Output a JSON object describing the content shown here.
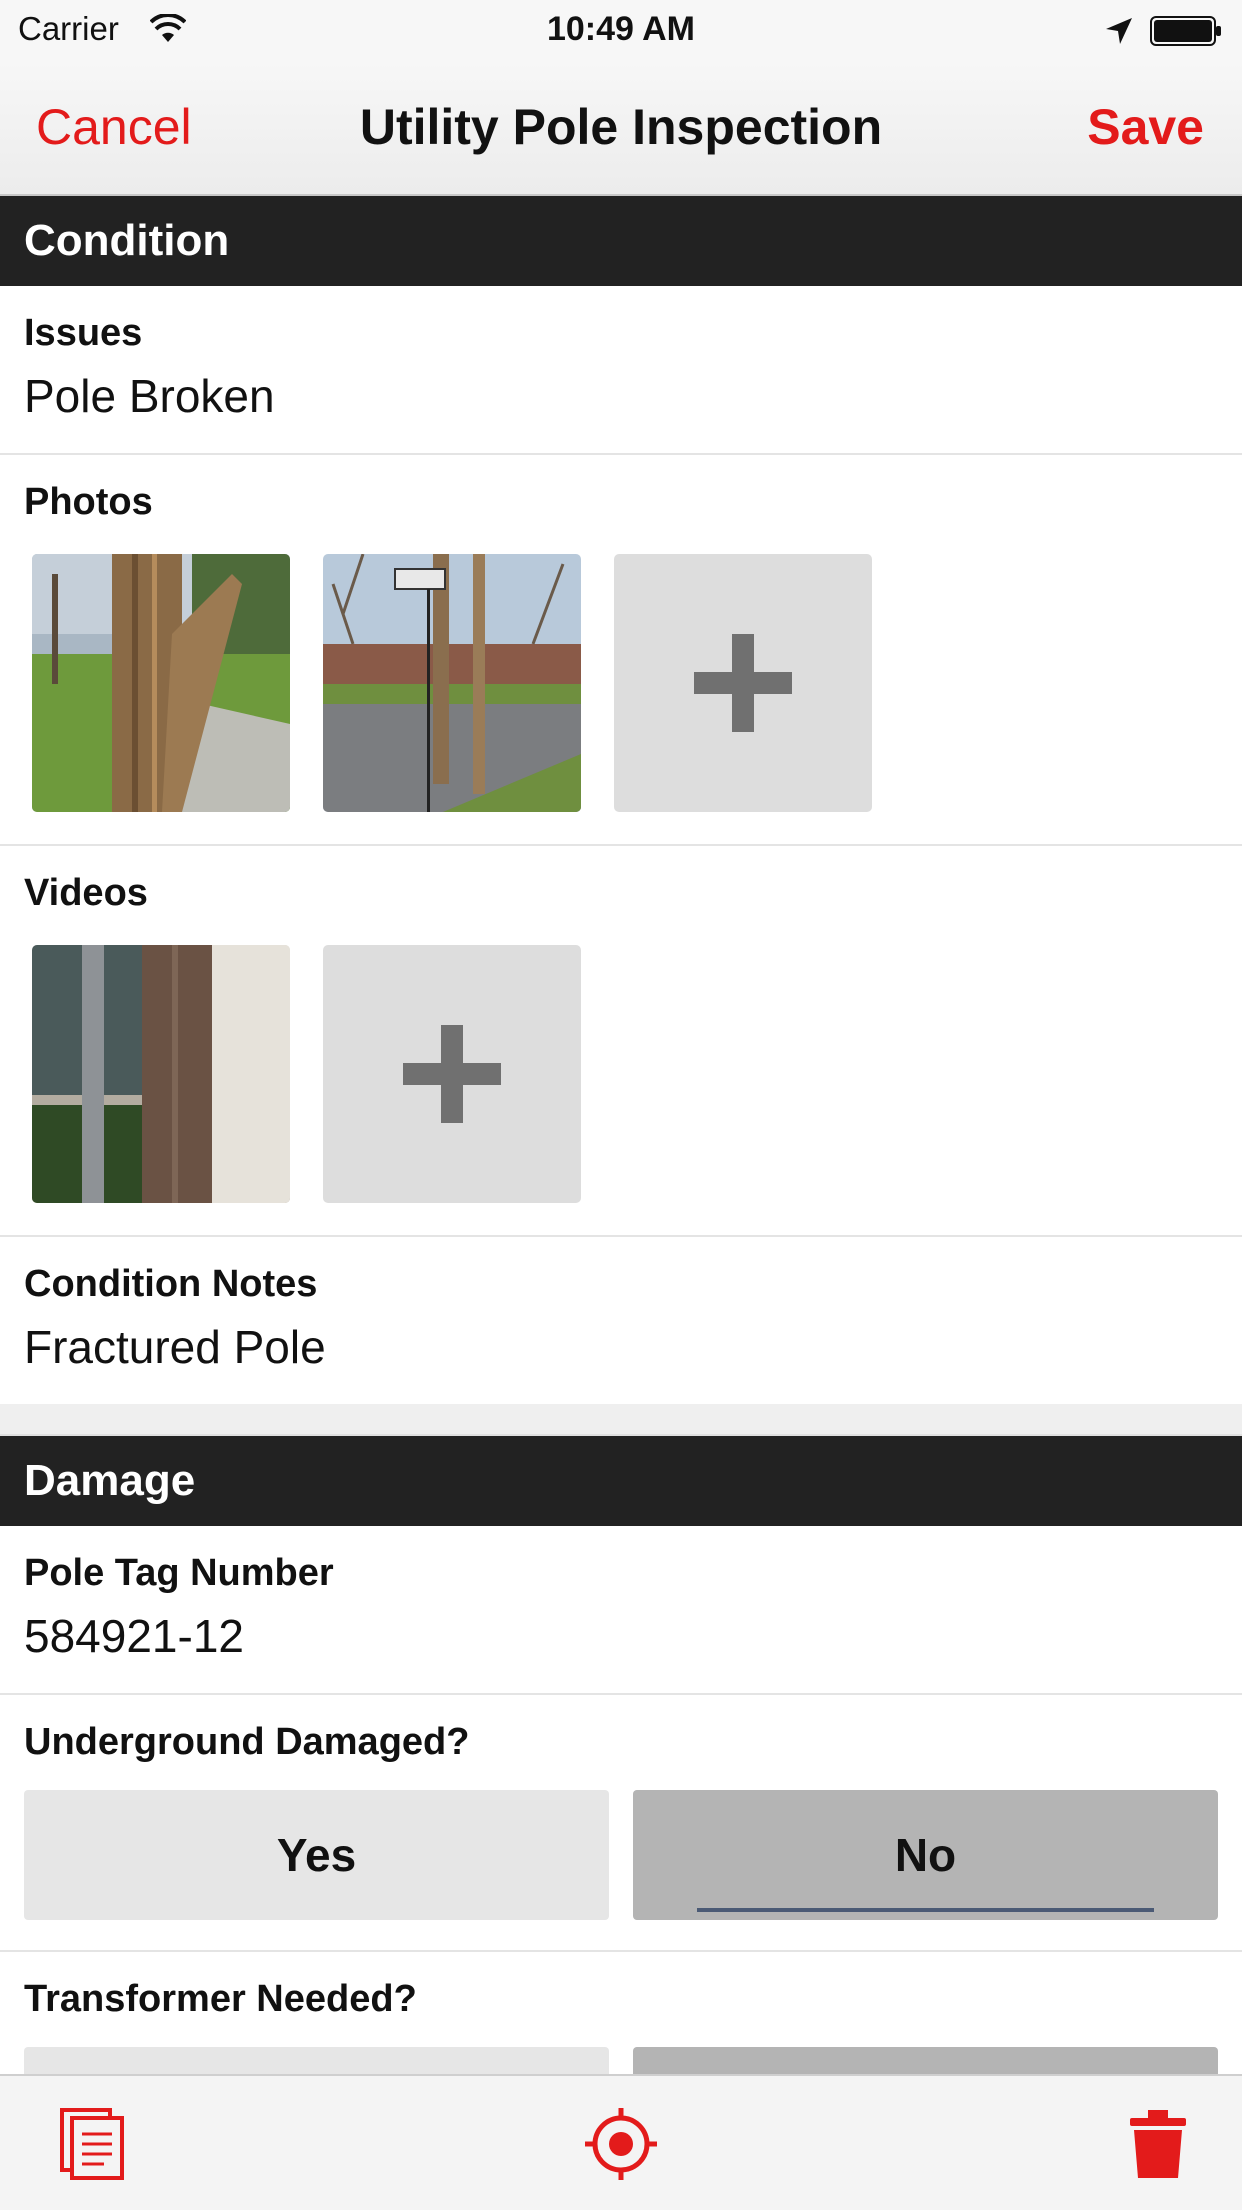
{
  "status_bar": {
    "carrier": "Carrier",
    "time": "10:49 AM",
    "icons": [
      "wifi-icon",
      "location-arrow-icon",
      "battery-icon"
    ]
  },
  "nav": {
    "cancel_label": "Cancel",
    "title": "Utility Pole Inspection",
    "save_label": "Save"
  },
  "condition": {
    "header": "Condition",
    "issues": {
      "label": "Issues",
      "value": "Pole Broken"
    },
    "photos": {
      "label": "Photos"
    },
    "videos": {
      "label": "Videos"
    },
    "notes": {
      "label": "Condition Notes",
      "value": "Fractured Pole"
    }
  },
  "damage": {
    "header": "Damage",
    "pole_tag": {
      "label": "Pole Tag Number",
      "value": "584921-12"
    },
    "underground": {
      "label": "Underground Damaged?",
      "options": [
        "Yes",
        "No"
      ],
      "selected": "No"
    },
    "transformer": {
      "label": "Transformer Needed?"
    }
  },
  "toolbar": {
    "icons": [
      "copy-document-icon",
      "locate-target-icon",
      "trash-icon"
    ]
  },
  "colors": {
    "accent": "#e31b1b",
    "section_header_bg": "#222222",
    "segment_selected": "#b4b4b4",
    "segment_unselected": "#e6e6e6"
  }
}
